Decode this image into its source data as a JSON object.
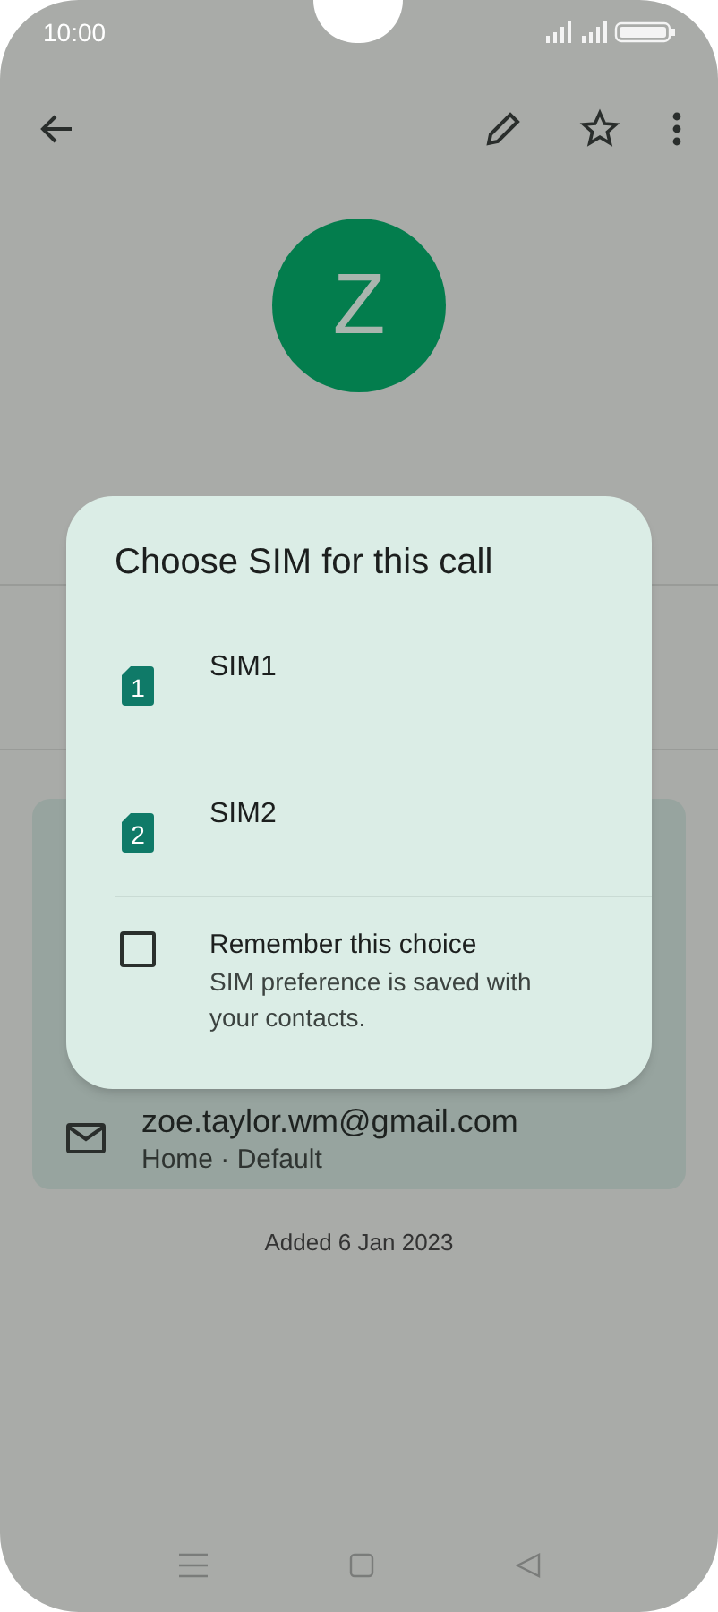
{
  "status_bar": {
    "time": "10:00"
  },
  "contact": {
    "initial": "Z"
  },
  "email": {
    "address": "zoe.taylor.wm@gmail.com",
    "label": "Home · Default"
  },
  "added": "Added 6 Jan 2023",
  "dialog": {
    "title": "Choose SIM for this call",
    "options": [
      {
        "label": "SIM1",
        "badge": "1"
      },
      {
        "label": "SIM2",
        "badge": "2"
      }
    ],
    "remember": {
      "label": "Remember this choice",
      "description": "SIM preference is saved with your contacts.",
      "checked": false
    }
  }
}
